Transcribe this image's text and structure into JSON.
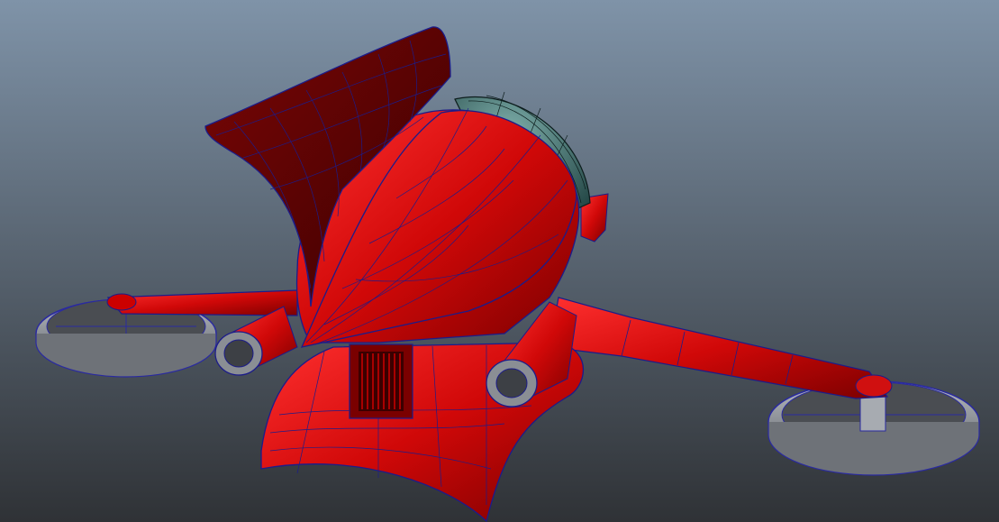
{
  "viewport": {
    "background_top": "#7f93a8",
    "background_bottom": "#2f3236",
    "model_color": "#c80808",
    "wire_color": "#1c1c8a",
    "canopy_color": "#3e6b6a",
    "fan_color": "#8c8f95"
  }
}
